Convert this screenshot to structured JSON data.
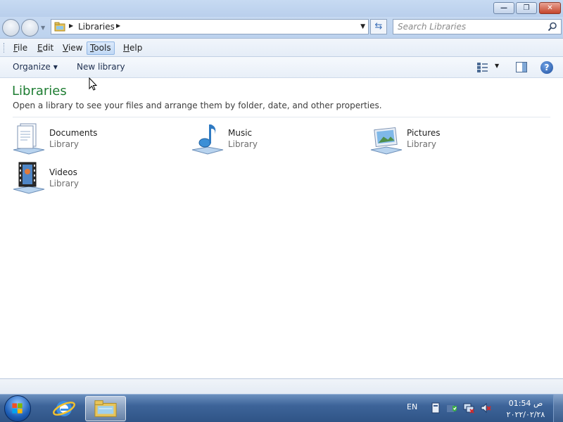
{
  "window": {
    "minimize_label": "—",
    "maximize_label": "❐",
    "close_label": "✕"
  },
  "address": {
    "crumb": "Libraries",
    "search_placeholder": "Search Libraries"
  },
  "menu": {
    "items": [
      {
        "label": "File",
        "underline": "F",
        "rest": "ile"
      },
      {
        "label": "Edit",
        "underline": "E",
        "rest": "dit"
      },
      {
        "label": "View",
        "underline": "V",
        "rest": "iew"
      },
      {
        "label": "Tools",
        "underline": "T",
        "rest": "ools"
      },
      {
        "label": "Help",
        "underline": "H",
        "rest": "elp"
      }
    ],
    "active": "Tools"
  },
  "commands": {
    "organize": "Organize",
    "new_library": "New library"
  },
  "content": {
    "title": "Libraries",
    "subtitle": "Open a library to see your files and arrange them by folder, date, and other properties.",
    "libraries": [
      {
        "name": "Documents",
        "type": "Library",
        "icon": "documents-library-icon"
      },
      {
        "name": "Music",
        "type": "Library",
        "icon": "music-library-icon"
      },
      {
        "name": "Pictures",
        "type": "Library",
        "icon": "pictures-library-icon"
      },
      {
        "name": "Videos",
        "type": "Library",
        "icon": "videos-library-icon"
      }
    ]
  },
  "taskbar": {
    "language": "EN",
    "time": "01:54 ص",
    "date": "٢٠٢٢/٠٢/٢٨"
  },
  "colors": {
    "heading_green": "#1e7d32",
    "taskbar_blue": "#3d6499",
    "menu_active": "#c1d9f5"
  }
}
